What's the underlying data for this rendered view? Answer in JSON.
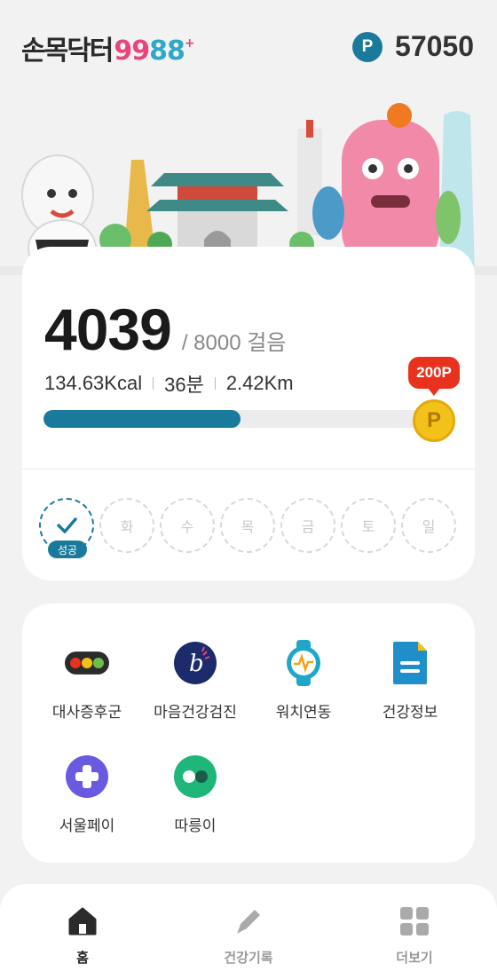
{
  "header": {
    "logo_text": "손목닥터",
    "logo_num_a": "99",
    "logo_num_b": "88",
    "logo_plus": "+",
    "points_icon": "P",
    "points_value": "57050"
  },
  "steps": {
    "current": "4039",
    "goal": "/ 8000 걸음",
    "kcal": "134.63Kcal",
    "minutes": "36분",
    "distance": "2.42Km",
    "progress_fraction": 0.505,
    "reward_label": "200P",
    "coin_label": "P"
  },
  "week": {
    "done_tag": "성공",
    "days": [
      "화",
      "수",
      "목",
      "금",
      "토",
      "일"
    ]
  },
  "menu": {
    "items": [
      {
        "label": "대사증후군",
        "icon": "traffic-light-icon"
      },
      {
        "label": "마음건강검진",
        "icon": "mind-check-icon"
      },
      {
        "label": "워치연동",
        "icon": "watch-icon"
      },
      {
        "label": "건강정보",
        "icon": "document-icon"
      },
      {
        "label": "서울페이",
        "icon": "seoul-pay-icon"
      },
      {
        "label": "따릉이",
        "icon": "bike-icon"
      }
    ]
  },
  "nav": {
    "home": "홈",
    "records": "건강기록",
    "more": "더보기"
  },
  "colors": {
    "accent": "#1a7a9c",
    "coin": "#f3c21a",
    "reward": "#e8321e"
  }
}
